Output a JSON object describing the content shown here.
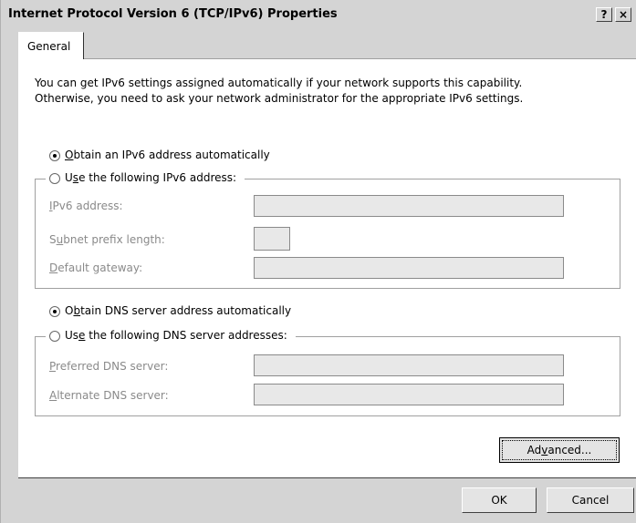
{
  "window": {
    "title": "Internet Protocol Version 6 (TCP/IPv6) Properties",
    "help_glyph": "?",
    "close_glyph": "×"
  },
  "tabs": [
    {
      "label": "General",
      "selected": true
    }
  ],
  "description": {
    "line1": "You can get IPv6 settings assigned automatically if your network supports this capability.",
    "line2": "Otherwise, you need to ask your network administrator for the appropriate IPv6 settings."
  },
  "ip_section": {
    "auto": {
      "pre": "",
      "accel": "O",
      "post": "btain an IPv6 address automatically",
      "selected": true
    },
    "manual": {
      "pre": "U",
      "accel": "s",
      "post": "e the following IPv6 address:",
      "selected": false
    },
    "fields": [
      {
        "pre": "",
        "accel": "I",
        "post": "Pv6 address:",
        "value": ""
      },
      {
        "pre": "S",
        "accel": "u",
        "post": "bnet prefix length:",
        "value": ""
      },
      {
        "pre": "",
        "accel": "D",
        "post": "efault gateway:",
        "value": ""
      }
    ]
  },
  "dns_section": {
    "auto": {
      "pre": "O",
      "accel": "b",
      "post": "tain DNS server address automatically",
      "selected": true
    },
    "manual": {
      "pre": "Us",
      "accel": "e",
      "post": " the following DNS server addresses:",
      "selected": false
    },
    "fields": [
      {
        "pre": "",
        "accel": "P",
        "post": "referred DNS server:",
        "value": ""
      },
      {
        "pre": "",
        "accel": "A",
        "post": "lternate DNS server:",
        "value": ""
      }
    ]
  },
  "buttons": {
    "advanced": {
      "pre": "Ad",
      "accel": "v",
      "post": "anced..."
    },
    "ok": "OK",
    "cancel": "Cancel"
  }
}
